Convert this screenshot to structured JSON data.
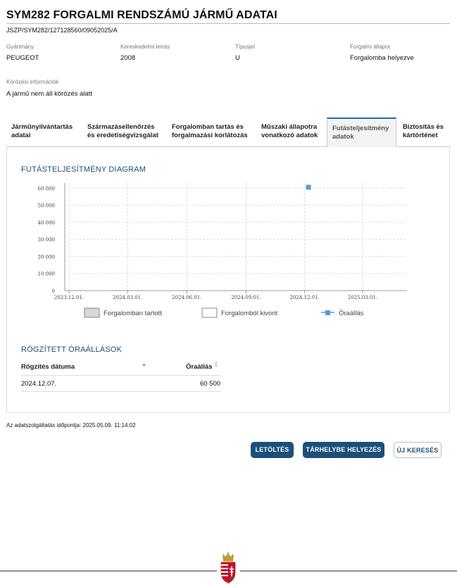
{
  "header": {
    "title": "SYM282 FORGALMI RENDSZÁMÚ JÁRMŰ ADATAI",
    "doc_id": "JSZP/SYM282/127128560/09052025/A"
  },
  "fields": [
    {
      "label": "Gyártmány",
      "value": "PEUGEOT"
    },
    {
      "label": "Kereskedelmi leírás",
      "value": "2008"
    },
    {
      "label": "Típusjel",
      "value": "U"
    },
    {
      "label": "Forgalmi állapot",
      "value": "Forgalomba helyezve"
    }
  ],
  "wanted": {
    "label": "Körözési információk",
    "value": "A jármű nem áll körözés alatt"
  },
  "tabs": [
    {
      "line1": "Járműnyilvántartás",
      "line2": "adatai",
      "active": false
    },
    {
      "line1": "Származásellenőrzés",
      "line2": "és eredetiségvizsgálat",
      "active": false
    },
    {
      "line1": "Forgalomban tartás és",
      "line2": "forgalmazási korlátozás",
      "active": false
    },
    {
      "line1": "Műszaki állapotra",
      "line2": "vonatkozó adatok",
      "active": false
    },
    {
      "line1": "Futásteljesítmény",
      "line2": "adatok",
      "active": true
    },
    {
      "line1": "Biztosítás és",
      "line2": "kártörténet",
      "active": false
    }
  ],
  "diagram": {
    "title": "FUTÁSTELJESÍTMÉNY DIAGRAM"
  },
  "chart_data": {
    "type": "scatter",
    "title": "FUTÁSTELJESÍTMÉNY DIAGRAM",
    "xlabel": "",
    "ylabel": "",
    "y_ticks": [
      "0",
      "10 000",
      "20 000",
      "30 000",
      "40 000",
      "50 000",
      "60 000"
    ],
    "y_tick_values": [
      0,
      10000,
      20000,
      30000,
      40000,
      50000,
      60000
    ],
    "ylim": [
      0,
      63000
    ],
    "x_ticks": [
      "2023.12.01.",
      "2024.03.01.",
      "2024.06.01.",
      "2024.09.01.",
      "2024.12.01.",
      "2025.03.01."
    ],
    "x_tick_values": [
      "2023-12-01",
      "2024-03-01",
      "2024-06-01",
      "2024-09-01",
      "2024-12-01",
      "2025-03-01"
    ],
    "xlim": [
      "2023-12-01",
      "2025-05-09"
    ],
    "grid": true,
    "series": [
      {
        "name": "Óraállás",
        "points": [
          {
            "x": "2024-12-07",
            "y": 60500
          }
        ],
        "color": "#5b9bd5"
      }
    ],
    "legend": [
      {
        "name": "Forgalomban tartott",
        "kind": "box",
        "color": "#d8d8d8"
      },
      {
        "name": "Forgalomból kivont",
        "kind": "box",
        "color": "#ffffff"
      },
      {
        "name": "Óraállás",
        "kind": "marker",
        "color": "#5b9bd5"
      }
    ],
    "legend_position": "bottom"
  },
  "readings": {
    "title": "RÖGZÍTETT ÓRAÁLLÁSOK",
    "col_date": "Rögzítés dátuma",
    "col_value": "Óraállás",
    "rows": [
      {
        "date": "2024.12.07.",
        "value": "60 500"
      }
    ]
  },
  "footer": {
    "note": "Az adatszolgáltatás időpontja: 2025.05.09. 11:14:02"
  },
  "buttons": {
    "download": "LETÖLTÉS",
    "storage": "TÁRHELYBE HELYEZÉS",
    "new_search": "ÚJ KERESÉS"
  },
  "colors": {
    "accent": "#1b4f7a",
    "marker": "#5b9bd5"
  }
}
